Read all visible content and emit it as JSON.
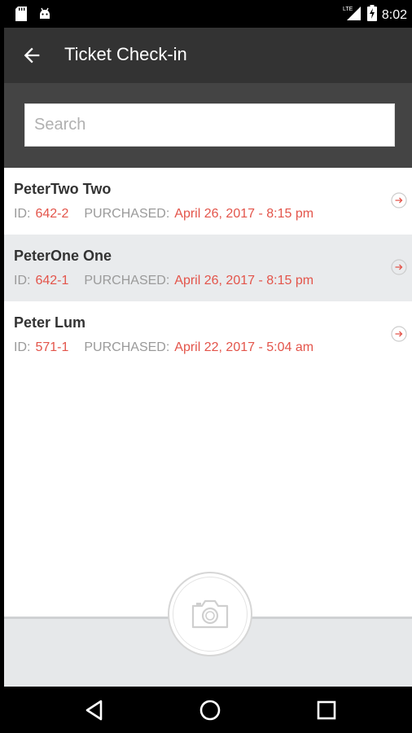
{
  "status_bar": {
    "time": "8:02",
    "network": "LTE"
  },
  "app_bar": {
    "title": "Ticket Check-in"
  },
  "search": {
    "placeholder": "Search",
    "value": ""
  },
  "tickets": [
    {
      "name": "PeterTwo Two",
      "id_label": "ID:",
      "id": "642-2",
      "purchased_label": "PURCHASED:",
      "purchased": "April 26, 2017 - 8:15 pm"
    },
    {
      "name": "PeterOne One",
      "id_label": "ID:",
      "id": "642-1",
      "purchased_label": "PURCHASED:",
      "purchased": "April 26, 2017 - 8:15 pm"
    },
    {
      "name": "Peter Lum",
      "id_label": "ID:",
      "id": "571-1",
      "purchased_label": "PURCHASED:",
      "purchased": "April 22, 2017 - 5:04 am"
    }
  ],
  "icons": {
    "back": "arrow-left-icon",
    "row_action": "arrow-right-circle-icon",
    "camera": "camera-icon",
    "nav_back": "triangle-back-icon",
    "nav_home": "circle-home-icon",
    "nav_recents": "square-recents-icon"
  },
  "colors": {
    "app_bar": "#333333",
    "search_area": "#444444",
    "accent": "#e3544a",
    "alt_row": "#e9ebed"
  }
}
